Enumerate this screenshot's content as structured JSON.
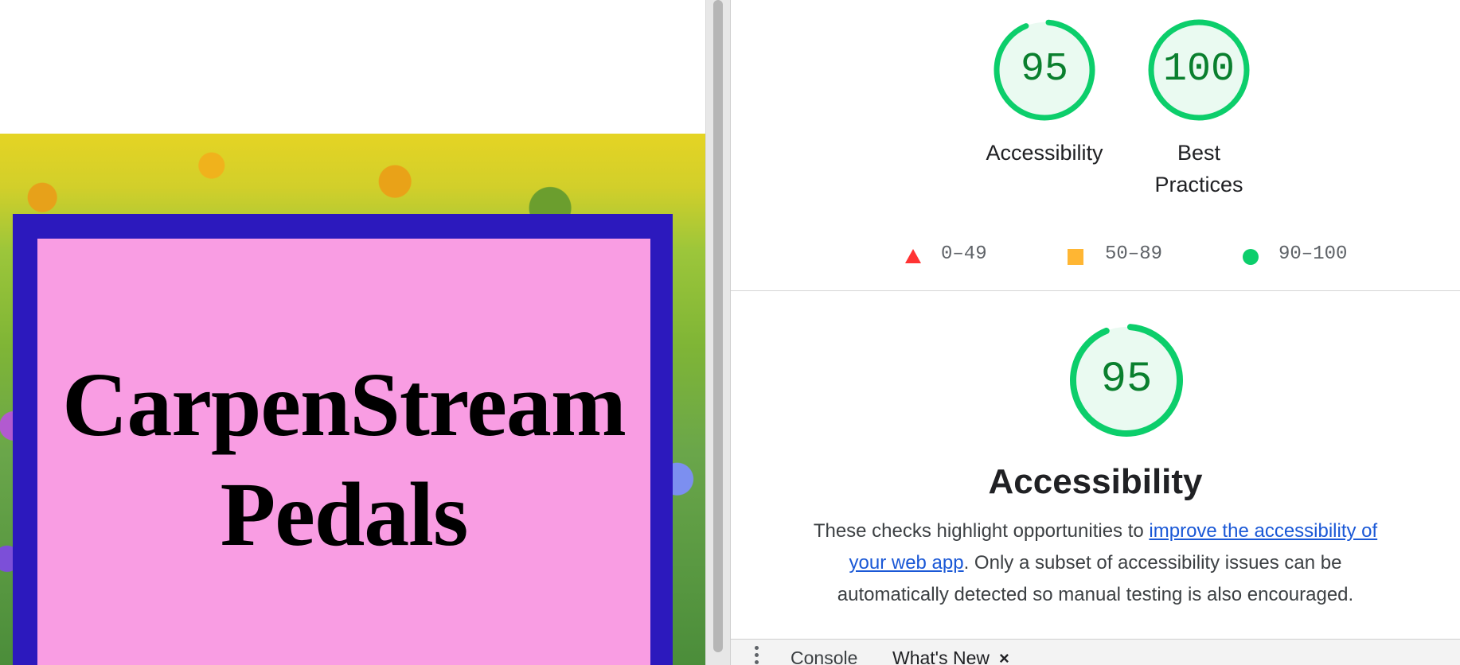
{
  "page": {
    "hero_title_line1": "CarpenStream",
    "hero_title_line2": "Pedals"
  },
  "scores": [
    {
      "label": "Accessibility",
      "value": "95",
      "score": 95
    },
    {
      "label": "Best Practices",
      "value": "100",
      "score": 100
    }
  ],
  "legend": [
    {
      "shape": "triangle",
      "color": "#ff3333",
      "label": "0–49"
    },
    {
      "shape": "square",
      "color": "#ffa400",
      "label": "50–89"
    },
    {
      "shape": "circle",
      "color": "#0cce6b",
      "label": "90–100"
    }
  ],
  "section": {
    "score": 95,
    "value": "95",
    "title": "Accessibility",
    "desc_before": "These checks highlight opportunities to ",
    "link_text": "improve the accessibility of your web app",
    "desc_after": ". Only a subset of accessibility issues can be automatically detected so manual testing is also encouraged."
  },
  "drawer": {
    "tabs": [
      {
        "label": "Console"
      },
      {
        "label": "What's New",
        "close": "×"
      }
    ]
  },
  "colors": {
    "pass_ring": "#0cce6b",
    "pass_fill": "#eafaf1",
    "pass_text": "#0a7f2e",
    "hero_frame": "#2c19bd",
    "hero_panel": "#f99de3",
    "link": "#1a58d6"
  }
}
